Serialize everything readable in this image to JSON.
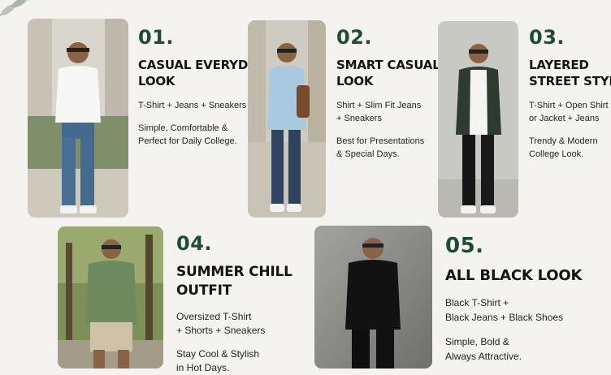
{
  "outfits": [
    {
      "number": "01.",
      "title_lines": [
        "CASUAL EVERYDAY",
        "LOOK"
      ],
      "combo_lines": [
        "T-Shirt + Jeans + Sneakers"
      ],
      "note_lines": [
        "Simple, Comfortable &",
        "Perfect for Daily College."
      ]
    },
    {
      "number": "02.",
      "title_lines": [
        "SMART CASUAL",
        "LOOK"
      ],
      "combo_lines": [
        "Shirt + Slim Fit Jeans",
        "+ Sneakers"
      ],
      "note_lines": [
        "Best for Presentations",
        "& Special Days."
      ]
    },
    {
      "number": "03.",
      "title_lines": [
        "LAYERED",
        "STREET STYLE"
      ],
      "combo_lines": [
        "T-Shirt + Open Shirt",
        "or Jacket + Jeans"
      ],
      "note_lines": [
        "Trendy & Modern",
        "College Look."
      ]
    },
    {
      "number": "04.",
      "title_lines": [
        "SUMMER CHILL",
        "OUTFIT"
      ],
      "combo_lines": [
        "Oversized T-Shirt",
        "+ Shorts + Sneakers"
      ],
      "note_lines": [
        "Stay Cool & Stylish",
        "in Hot Days."
      ]
    },
    {
      "number": "05.",
      "title_lines": [
        "ALL BLACK LOOK"
      ],
      "combo_lines": [
        "Black T-Shirt +",
        "Black Jeans + Black Shoes"
      ],
      "note_lines": [
        "Simple, Bold &",
        "Always Attractive."
      ]
    }
  ],
  "colors": {
    "accent_green": "#1f4d33",
    "background": "#f4f3f0"
  },
  "icons": [
    "leaf-decoration-icon"
  ]
}
